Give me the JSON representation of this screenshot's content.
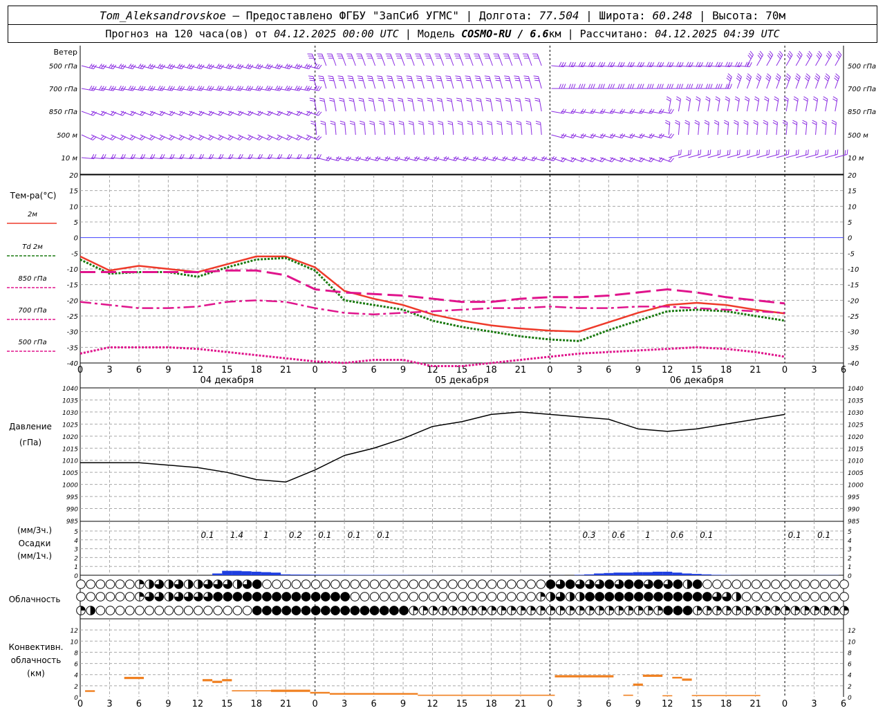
{
  "header": {
    "line1": {
      "station": "Tom_Aleksandrovskoe",
      "provided": "– Предоставлено ФГБУ \"ЗапСиб УГМС\" | Долгота:",
      "lon": "77.504",
      "lat_label": "| Широта:",
      "lat": "60.248",
      "alt_label": "| Высота:",
      "alt": "70м"
    },
    "line2": {
      "forecast": "Прогноз на 120 часа(ов) от",
      "from": "04.12.2025 00:00 UTC",
      "model_label": "| Модель",
      "model": "COSMO-RU / 6.6",
      "model_unit": "км",
      "calc_label": "| Рассчитано:",
      "calc": "04.12.2025 04:39 UTC"
    }
  },
  "colors": {
    "wind": "#8a2be2",
    "t2m": "#ee3a2a",
    "td2m": "#1a7a10",
    "t850": "#e0148c",
    "t700": "#e0148c",
    "t500": "#e0148c",
    "pressure": "#000000",
    "precip": "#1f3fe0",
    "conv": "#f08020",
    "grid": "#a8a8a8",
    "zero": "#4040ff"
  },
  "time_axis": {
    "tick_labels": [
      "0",
      "3",
      "6",
      "9",
      "12",
      "15",
      "18",
      "21",
      "0",
      "3",
      "6",
      "9",
      "12",
      "15",
      "18",
      "21",
      "0",
      "3",
      "6",
      "9",
      "12",
      "15",
      "18",
      "21",
      "0",
      "3",
      "6"
    ],
    "day_labels": [
      {
        "text": "04 декабря",
        "at_hour": 15
      },
      {
        "text": "05 декабря",
        "at_hour": 39
      },
      {
        "text": "06 декабря",
        "at_hour": 63
      }
    ]
  },
  "wind_panel": {
    "title": "Ветер",
    "levels": [
      "500 гПа",
      "700 гПа",
      "850 гПа",
      "500 м",
      "10 м"
    ]
  },
  "chart_data": [
    {
      "type": "line",
      "name": "temperature",
      "title": "Тем-ра(°С)",
      "ylim": [
        -40,
        20
      ],
      "yticks": [
        20,
        15,
        10,
        5,
        0,
        -5,
        -10,
        -15,
        -20,
        -25,
        -30,
        -35,
        -40
      ],
      "x_unit": "hours from 04.12.2025 00 UTC",
      "series": [
        {
          "name": "2м",
          "key": "t2m",
          "style": "solid",
          "x": [
            0,
            3,
            6,
            9,
            12,
            15,
            18,
            21,
            24,
            27,
            30,
            33,
            36,
            39,
            42,
            45,
            48,
            51,
            54,
            57,
            60,
            63,
            66,
            69,
            72
          ],
          "values": [
            -6,
            -10.5,
            -9,
            -10,
            -11,
            -8.5,
            -6,
            -6,
            -9.5,
            -17,
            -19.5,
            -21.5,
            -24.5,
            -26.5,
            -28,
            -29,
            -29.7,
            -30,
            -27,
            -24,
            -21.5,
            -20.8,
            -21.5,
            -23,
            -24.2
          ]
        },
        {
          "name": "Td 2м",
          "key": "td2m",
          "style": "dotted",
          "x": [
            0,
            3,
            6,
            9,
            12,
            15,
            18,
            21,
            24,
            27,
            30,
            33,
            36,
            39,
            42,
            45,
            48,
            51,
            54,
            57,
            60,
            63,
            66,
            69,
            72
          ],
          "values": [
            -7,
            -11.5,
            -11,
            -11,
            -12.5,
            -9.5,
            -7,
            -6.5,
            -10.5,
            -20,
            -21.5,
            -23,
            -26.5,
            -28.5,
            -30,
            -31.5,
            -32.5,
            -33,
            -29.5,
            -26.5,
            -23.5,
            -23,
            -23.5,
            -25,
            -26.5
          ]
        },
        {
          "name": "850 гПа",
          "key": "t850",
          "style": "longdash",
          "x": [
            0,
            3,
            6,
            9,
            12,
            15,
            18,
            21,
            24,
            27,
            30,
            33,
            36,
            39,
            42,
            45,
            48,
            51,
            54,
            57,
            60,
            63,
            66,
            69,
            72
          ],
          "values": [
            -11,
            -11,
            -11,
            -11,
            -11,
            -10.5,
            -10.5,
            -12,
            -16.5,
            -17.5,
            -18,
            -18.5,
            -19.5,
            -20.5,
            -20.5,
            -19.5,
            -19,
            -19,
            -18.5,
            -17.5,
            -16.5,
            -17.5,
            -19,
            -20,
            -21
          ]
        },
        {
          "name": "700 гПа",
          "key": "t700",
          "style": "dashdot",
          "x": [
            0,
            3,
            6,
            9,
            12,
            15,
            18,
            21,
            24,
            27,
            30,
            33,
            36,
            39,
            42,
            45,
            48,
            51,
            54,
            57,
            60,
            63,
            66,
            69,
            72
          ],
          "values": [
            -20.5,
            -21.5,
            -22.5,
            -22.5,
            -22,
            -20.5,
            -20,
            -20.5,
            -22.5,
            -24,
            -24.5,
            -24,
            -23.5,
            -23,
            -22.5,
            -22.5,
            -22,
            -22.5,
            -22.5,
            -22,
            -22,
            -22.5,
            -23,
            -23.5,
            -24
          ]
        },
        {
          "name": "500 гПа",
          "key": "t500",
          "style": "dotted",
          "x": [
            0,
            3,
            6,
            9,
            12,
            15,
            18,
            21,
            24,
            27,
            30,
            33,
            36,
            39,
            42,
            45,
            48,
            51,
            54,
            57,
            60,
            63,
            66,
            69,
            72
          ],
          "values": [
            -37,
            -35,
            -35,
            -35,
            -35.5,
            -36.5,
            -37.5,
            -38.5,
            -39.5,
            -40,
            -39,
            -39,
            -41,
            -41,
            -40,
            -39,
            -38,
            -37,
            -36.5,
            -36,
            -35.5,
            -35,
            -35.5,
            -36.5,
            -38
          ]
        }
      ]
    },
    {
      "type": "line",
      "name": "pressure",
      "title_lines": [
        "Давление",
        "(гПа)"
      ],
      "ylim": [
        985,
        1040
      ],
      "yticks": [
        1040,
        1035,
        1030,
        1025,
        1020,
        1015,
        1010,
        1005,
        1000,
        995,
        990,
        985
      ],
      "series": [
        {
          "key": "pressure",
          "x": [
            0,
            3,
            6,
            9,
            12,
            15,
            18,
            21,
            24,
            27,
            30,
            33,
            36,
            39,
            42,
            45,
            48,
            51,
            54,
            57,
            60,
            63,
            66,
            69,
            72
          ],
          "values": [
            1009,
            1009,
            1009,
            1008,
            1007,
            1005,
            1002,
            1001,
            1006,
            1012,
            1015,
            1019,
            1024,
            1026,
            1029,
            1030,
            1029,
            1028,
            1027,
            1023,
            1022,
            1023,
            1025,
            1027,
            1029
          ]
        }
      ]
    },
    {
      "type": "bar",
      "name": "precipitation",
      "title_lines": [
        "(мм/3ч.)",
        "Осадки",
        "(мм/1ч.)"
      ],
      "ylim": [
        0,
        5
      ],
      "yticks": [
        5,
        4,
        3,
        2,
        1,
        0
      ],
      "labels": [
        {
          "at_hour": 13,
          "text": "0.1"
        },
        {
          "at_hour": 16,
          "text": "1.4"
        },
        {
          "at_hour": 19,
          "text": "1"
        },
        {
          "at_hour": 22,
          "text": "0.2"
        },
        {
          "at_hour": 25,
          "text": "0.1"
        },
        {
          "at_hour": 28,
          "text": "0.1"
        },
        {
          "at_hour": 31,
          "text": "0.1"
        },
        {
          "at_hour": 52,
          "text": "0.3"
        },
        {
          "at_hour": 55,
          "text": "0.6"
        },
        {
          "at_hour": 58,
          "text": "1"
        },
        {
          "at_hour": 61,
          "text": "0.6"
        },
        {
          "at_hour": 64,
          "text": "0.1"
        },
        {
          "at_hour": 73,
          "text": "0.1"
        },
        {
          "at_hour": 76,
          "text": "0.1"
        }
      ],
      "bars_x": [
        14,
        15,
        16,
        17,
        18,
        19,
        20,
        21,
        22,
        23,
        24,
        25,
        26,
        27,
        28,
        29,
        30,
        31,
        32,
        33,
        34,
        35,
        36,
        37,
        38,
        39,
        40,
        41,
        42,
        43,
        44,
        45,
        46,
        47,
        48,
        49,
        50,
        51,
        52,
        53,
        54,
        55,
        56,
        57,
        58,
        59,
        60,
        61,
        62,
        63,
        64,
        65,
        66,
        67,
        68,
        69,
        70,
        71,
        72,
        73,
        74,
        75,
        76,
        77
      ],
      "bars": [
        0.2,
        0.5,
        0.5,
        0.45,
        0.4,
        0.35,
        0.3,
        0.1,
        0.08,
        0.07,
        0.06,
        0.05,
        0.05,
        0.05,
        0.04,
        0.04,
        0.04,
        0.04,
        0.03,
        0.03,
        0.02,
        0.02,
        0.02,
        0.01,
        0.01,
        0.01,
        0.01,
        0.01,
        0.01,
        0.01,
        0.01,
        0.01,
        0.01,
        0.01,
        0.01,
        0.01,
        0,
        0.05,
        0.1,
        0.2,
        0.25,
        0.3,
        0.3,
        0.35,
        0.35,
        0.4,
        0.4,
        0.3,
        0.2,
        0.15,
        0.1,
        0.05,
        0.03,
        0.02,
        0.01,
        0.01,
        0.01,
        0.01,
        0.01,
        0.01,
        0.01,
        0.01,
        0.02,
        0.02
      ]
    },
    {
      "type": "table",
      "name": "cloudiness",
      "title": "Облачность",
      "rows_note": "cloud cover fraction 0..1 per hour: upper, middle, lower",
      "upper": [
        0,
        0,
        0,
        0,
        0,
        0,
        0.25,
        0.5,
        0.75,
        0.5,
        0.75,
        0.5,
        0.5,
        0.75,
        0.75,
        0.75,
        0.5,
        0.75,
        1,
        0,
        0,
        0,
        0,
        0,
        0,
        0,
        0,
        0,
        0,
        0,
        0,
        0,
        0,
        0,
        0,
        0,
        0,
        0,
        0,
        0,
        0,
        0,
        0,
        0,
        0,
        0,
        0,
        0,
        1,
        0.75,
        1,
        0.75,
        0.75,
        0.75,
        1,
        0.75,
        1,
        1,
        0.75,
        1,
        0.75,
        1,
        0.5,
        1,
        0,
        0,
        0,
        0,
        0,
        0,
        0,
        0,
        0,
        0,
        0,
        0,
        0,
        0,
        0,
        0,
        0
      ],
      "middle": [
        0,
        0,
        0,
        0,
        0,
        0,
        0.25,
        0.75,
        0.75,
        0.5,
        0.75,
        0.75,
        0.75,
        0.75,
        1,
        1,
        1,
        1,
        1,
        1,
        1,
        1,
        1,
        1,
        1,
        1,
        1,
        1,
        0,
        0,
        0,
        0,
        0,
        0,
        0,
        0,
        0,
        0,
        0,
        0,
        0,
        0,
        0,
        0,
        0,
        0,
        0,
        0.25,
        0.5,
        0.75,
        0.5,
        0.5,
        1,
        1,
        1,
        1,
        1,
        1,
        1,
        1,
        1,
        1,
        1,
        1,
        1,
        0.75,
        0.75,
        0.5,
        0,
        0,
        0,
        0,
        0,
        0,
        0,
        0,
        0,
        0,
        0,
        0,
        0
      ],
      "lower": [
        0.25,
        0.5,
        0,
        0,
        0,
        0,
        0,
        0,
        0,
        0,
        0,
        0,
        0,
        0,
        0,
        0,
        0,
        0,
        1,
        1,
        1,
        1,
        1,
        1,
        1,
        1,
        1,
        1,
        1,
        1,
        1,
        1,
        1,
        1,
        0.25,
        0.25,
        0.25,
        0.25,
        0.25,
        0.25,
        0.25,
        0.25,
        0.25,
        0.25,
        0.25,
        0.25,
        0.25,
        0.25,
        0.25,
        0.25,
        0.25,
        0.25,
        0.25,
        0.25,
        0.25,
        0.25,
        0.25,
        0.25,
        0.25,
        0.25,
        1,
        1,
        1,
        0.25,
        0.25,
        0.25,
        0.25,
        0.25,
        0.25,
        0.25,
        0.25,
        0.25,
        0.25,
        0.25,
        0.25,
        0.25,
        0.25,
        0.25,
        0.25,
        1,
        1
      ]
    },
    {
      "type": "bar",
      "name": "convective_cloud",
      "title_lines": [
        "Конвективн.",
        "облачность",
        "(км)"
      ],
      "ylim": [
        0,
        14
      ],
      "yticks": [
        12,
        10,
        8,
        6,
        4,
        2,
        0
      ],
      "segments_note": "each segment: start hour, end hour, base km, top km",
      "segments": [
        [
          0.5,
          1.5,
          0.9,
          1.2
        ],
        [
          4.5,
          6.5,
          3.2,
          3.6
        ],
        [
          12.5,
          13.5,
          2.8,
          3.2
        ],
        [
          13.5,
          14.5,
          2.5,
          2.9
        ],
        [
          14.5,
          15.5,
          2.8,
          3.2
        ],
        [
          15.5,
          19.5,
          1.0,
          1.2
        ],
        [
          19.5,
          23.5,
          0.9,
          1.3
        ],
        [
          23.5,
          25.5,
          0.6,
          0.9
        ],
        [
          25.5,
          34.5,
          0.4,
          0.7
        ],
        [
          34.5,
          48.5,
          0.2,
          0.4
        ],
        [
          48.5,
          54.5,
          3.5,
          3.9
        ],
        [
          55.5,
          56.5,
          0.2,
          0.4
        ],
        [
          56.5,
          57.5,
          2.0,
          2.4
        ],
        [
          57.5,
          59.5,
          3.6,
          4.0
        ],
        [
          59.5,
          60.5,
          0.2,
          0.3
        ],
        [
          60.5,
          61.5,
          3.3,
          3.6
        ],
        [
          61.5,
          62.5,
          2.9,
          3.3
        ],
        [
          62.5,
          69.5,
          0.2,
          0.35
        ]
      ]
    }
  ]
}
